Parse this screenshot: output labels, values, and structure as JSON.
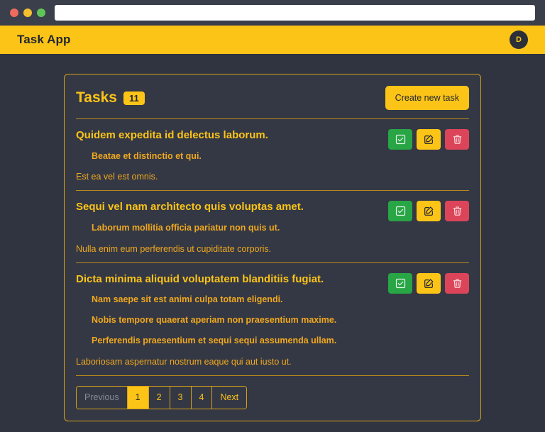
{
  "browser": {
    "url_value": "",
    "url_placeholder": "",
    "traffic_lights": [
      "close-red",
      "minimize-yellow",
      "maximize-green"
    ]
  },
  "navbar": {
    "title": "Task App",
    "avatar_initial": "D"
  },
  "card": {
    "heading": "Tasks",
    "count_badge": "11",
    "create_button": "Create new task"
  },
  "actions": {
    "complete_label": "Complete task",
    "edit_label": "Edit task",
    "delete_label": "Delete task"
  },
  "tasks": [
    {
      "title": "Quidem expedita id delectus laborum.",
      "subitems": [
        "Beatae et distinctio et qui."
      ],
      "description": "Est ea vel est omnis."
    },
    {
      "title": "Sequi vel nam architecto quis voluptas amet.",
      "subitems": [
        "Laborum mollitia officia pariatur non quis ut."
      ],
      "description": "Nulla enim eum perferendis ut cupiditate corporis."
    },
    {
      "title": "Dicta minima aliquid voluptatem blanditiis fugiat.",
      "subitems": [
        "Nam saepe sit est animi culpa totam eligendi.",
        "Nobis tempore quaerat aperiam non praesentium maxime.",
        "Perferendis praesentium et sequi sequi assumenda ullam."
      ],
      "description": "Laboriosam aspernatur nostrum eaque qui aut iusto ut."
    }
  ],
  "pagination": {
    "previous": "Previous",
    "pages": [
      "1",
      "2",
      "3",
      "4"
    ],
    "next": "Next",
    "active_page": "1"
  },
  "colors": {
    "accent": "#fcc417",
    "page_background": "#2f3440",
    "card_background": "#343845",
    "navbar": "#fcc417",
    "complete": "#28a545",
    "edit": "#fcc417",
    "delete": "#dc4559",
    "border": "#d6a117"
  }
}
